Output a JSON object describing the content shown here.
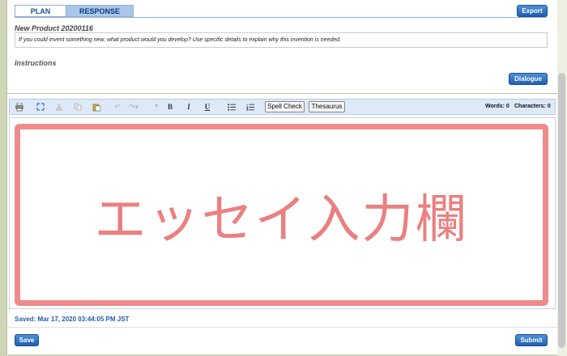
{
  "tabs": [
    {
      "label": "PLAN"
    },
    {
      "label": "RESPONSE"
    }
  ],
  "buttons": {
    "export": "Export",
    "dialogue": "Dialogue",
    "save": "Save",
    "submit": "Submit"
  },
  "product": {
    "title": "New Product 20200116",
    "prompt": "If you could invent something new, what product would you develop? Use specific details to explain why this invention is needed."
  },
  "instructions_label": "Instructions",
  "toolbar": {
    "icons": [
      "print-icon",
      "expand-icon",
      "cut-icon",
      "copy-icon",
      "paste-icon",
      "undo-icon",
      "redo-icon",
      "bold-icon",
      "italic-icon",
      "underline-icon",
      "bullet-list-icon",
      "numbered-list-icon"
    ],
    "bold": "B",
    "italic": "I",
    "underline": "U",
    "spell_check": "Spell Check",
    "thesaurus": "Thesaurus",
    "words": "Words: 0",
    "characters": "Characters: 0"
  },
  "editor": {
    "placeholder_text": "エッセイ入力欄"
  },
  "saved_status": "Saved: Mar 17, 2020 03:44:05 PM JST",
  "colors": {
    "tab_active": "#a9c7ea",
    "button_blue": "#1f5fae",
    "essay_border": "#ef8b8b",
    "saved_text": "#1e5fa8"
  }
}
